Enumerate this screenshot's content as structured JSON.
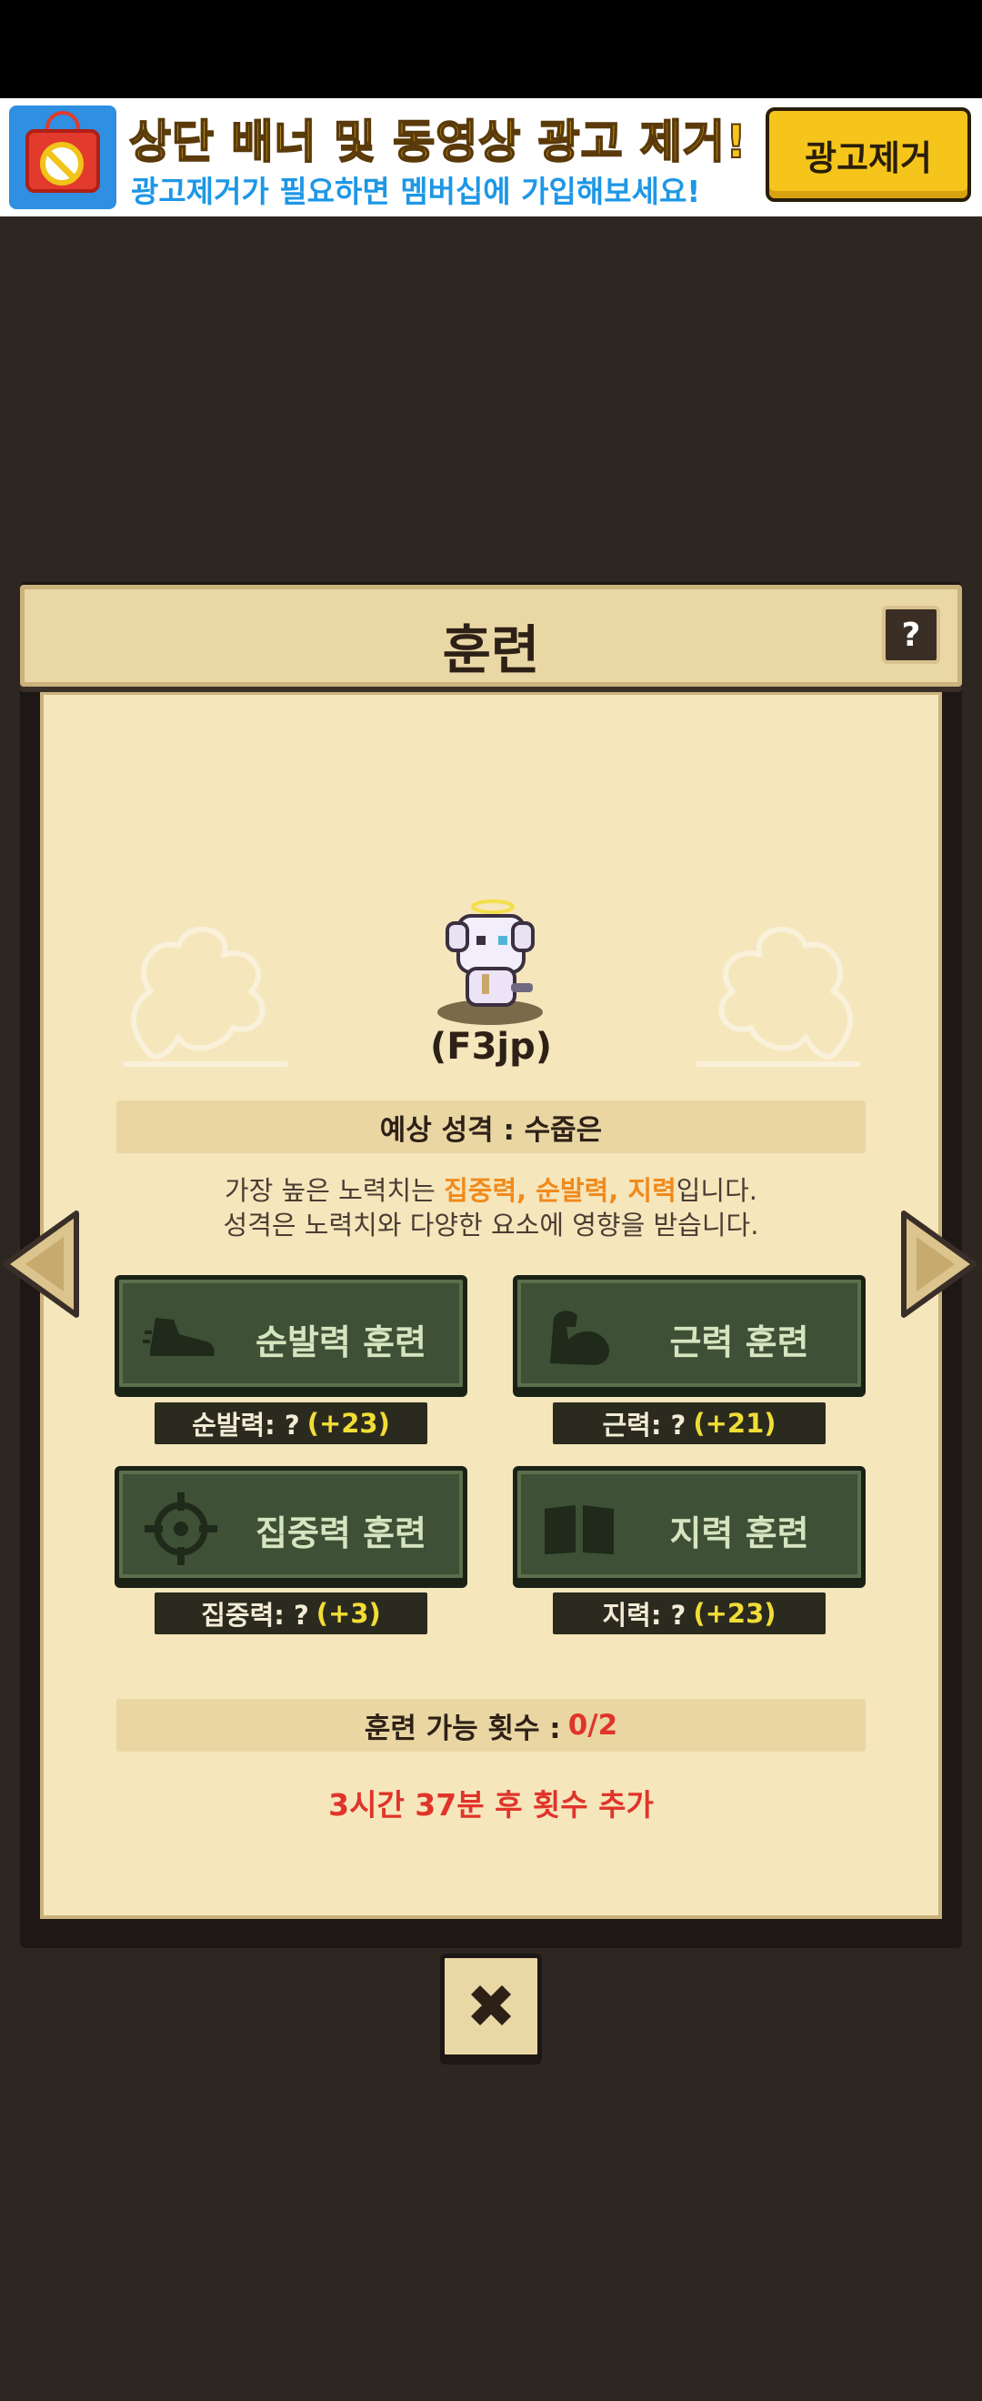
{
  "ad": {
    "title": "상단 배너 및 동영상 광고 제거!",
    "subtitle": "광고제거가 필요하면 멤버십에 가입해보세요!",
    "remove_button": "광고제거"
  },
  "dialog": {
    "title": "훈련",
    "help": "?",
    "character_name": "(F3jp)",
    "expected_personality": "예상 성격 : 수줍은",
    "info_line1_prefix": "가장 높은 노력치는 ",
    "info_line1_highlight": "집중력, 순발력, 지력",
    "info_line1_suffix": "입니다.",
    "info_line2": "성격은 노력치와 다양한 요소에 영향을 받습니다.",
    "trainings": [
      {
        "label": "순발력 훈련",
        "stat": "순발력: ?",
        "bonus": "(+23)"
      },
      {
        "label": "근력 훈련",
        "stat": "근력: ?",
        "bonus": "(+21)"
      },
      {
        "label": "집중력 훈련",
        "stat": "집중력: ?",
        "bonus": "(+3)"
      },
      {
        "label": "지력 훈련",
        "stat": "지력: ?",
        "bonus": "(+23)"
      }
    ],
    "count_label": "훈련 가능 횟수 :",
    "count_value": "0/2",
    "refill_text": "3시간 37분 후 횟수 추가",
    "close": "✖"
  },
  "colors": {
    "background": "#2e2621",
    "panel": "#f6e6bc",
    "button_green": "#3e5035",
    "highlight_orange": "#f08a1c",
    "alert_red": "#e0342a",
    "bonus_yellow": "#f1dd36"
  }
}
